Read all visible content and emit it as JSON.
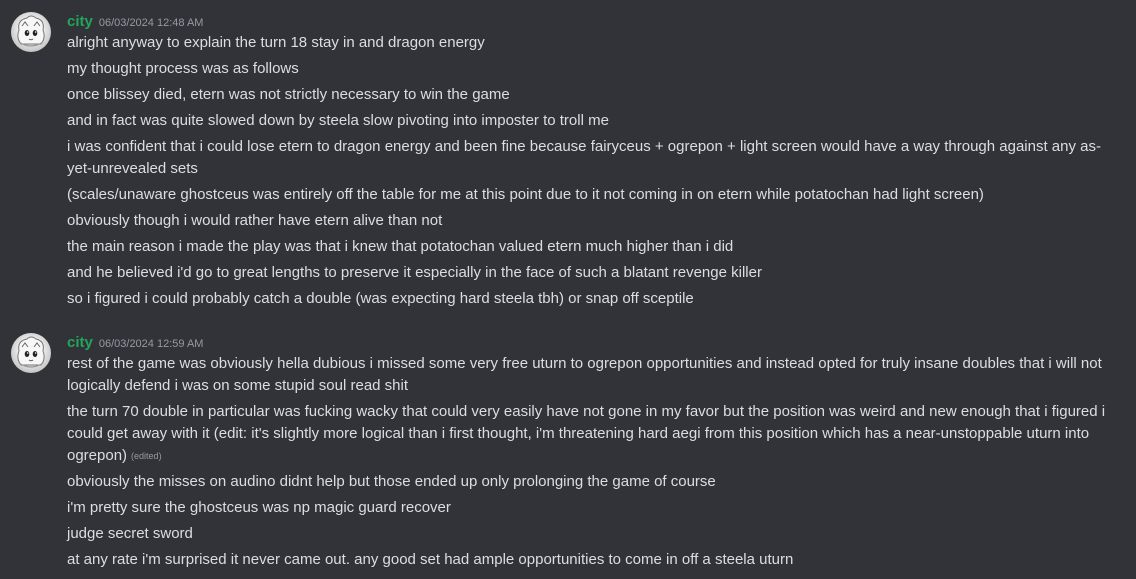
{
  "messages": [
    {
      "username": "city",
      "timestamp": "06/03/2024 12:48 AM",
      "lines": [
        "alright anyway to explain the turn 18 stay in and dragon energy",
        "my thought process was as follows",
        "once blissey died, etern was not strictly necessary to win the game",
        "and in fact was quite slowed down by steela slow pivoting into imposter to troll me",
        "i was confident that i could lose etern to dragon energy and been fine because fairyceus + ogrepon + light screen would have a way through against any as-yet-unrevealed sets",
        "(scales/unaware ghostceus was entirely off the table for me at this point due to it not coming in on etern while potatochan had light screen)",
        "obviously though i would rather have etern alive than not",
        "the main reason i made the play was that i knew that potatochan valued etern much higher than i did",
        "and he believed i'd go to great lengths to preserve it especially in the face of such a blatant revenge killer",
        "so i figured i could probably catch a double (was expecting hard steela tbh) or snap off sceptile"
      ]
    },
    {
      "username": "city",
      "timestamp": "06/03/2024 12:59 AM",
      "lines": [
        "rest of the game was obviously hella dubious i missed some very free uturn to ogrepon opportunities and instead opted for truly insane doubles that i will not logically defend i was on some stupid soul read shit",
        "the turn 70 double in particular was fucking wacky that could very easily have not gone in my favor but the position was weird and new enough that i figured i could get away with it (edit: it's slightly more logical than i first thought, i'm threatening hard aegi from this position which has a near-unstoppable uturn into ogrepon)",
        "obviously the misses on audino didnt help but those ended up only prolonging the game of course",
        "i'm pretty sure the ghostceus was np magic guard recover",
        "judge secret sword",
        "at any rate i'm surprised it never came out. any good set had ample opportunities to come in off a steela uturn"
      ],
      "edited_label": "(edited)"
    }
  ],
  "colors": {
    "background": "#313338",
    "username": "#23a55a",
    "text": "#dbdee1",
    "muted": "#949ba4"
  },
  "icons": {
    "avatar": "avatar-image"
  }
}
